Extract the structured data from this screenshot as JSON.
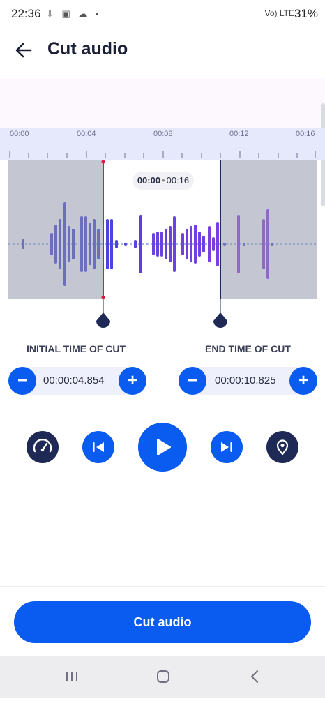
{
  "status_bar": {
    "time": "22:36",
    "left_icons": "⇩ ▣ ☁ •",
    "right_icons": "Vo) LTE",
    "battery": "31%"
  },
  "header": {
    "title": "Cut audio",
    "back_icon": "back-arrow-icon"
  },
  "timeline": {
    "ticks": [
      "00:00",
      "00:04",
      "00:08",
      "00:12",
      "00:16"
    ]
  },
  "waveform": {
    "selection_start": "00:00",
    "selection_end": "00:16",
    "colors": {
      "left": "#3b3fd0",
      "right": "#8a36d8",
      "selected_marker": "#e5173f",
      "end_marker": "#1e2a55",
      "dim": "#9498ac"
    }
  },
  "cut": {
    "initial_label": "INITIAL TIME OF CUT",
    "end_label": "END TIME OF CUT",
    "initial_value": "00:00:04.854",
    "end_value": "00:00:10.825",
    "minus": "−",
    "plus": "+"
  },
  "controls": {
    "speed_icon": "speedometer-icon",
    "prev_icon": "skip-previous-icon",
    "play_icon": "play-icon",
    "next_icon": "skip-next-icon",
    "marker_icon": "location-pin-icon"
  },
  "action": {
    "cut_label": "Cut audio"
  },
  "colors": {
    "accent": "#0a5bf0",
    "dark": "#1e2a55"
  }
}
